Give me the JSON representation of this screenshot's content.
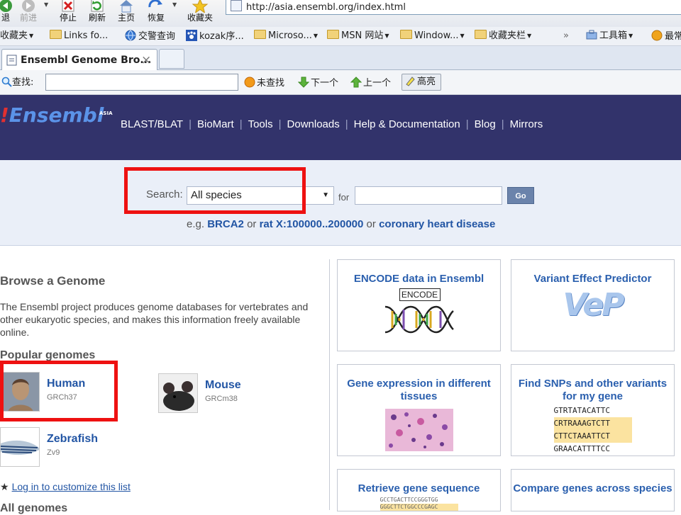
{
  "browser": {
    "nav_buttons": [
      {
        "label": "退",
        "icon": "back-icon"
      },
      {
        "label": "前进",
        "icon": "forward-icon"
      },
      {
        "label": "停止",
        "icon": "stop-icon"
      },
      {
        "label": "刷新",
        "icon": "refresh-icon"
      },
      {
        "label": "主页",
        "icon": "home-icon"
      },
      {
        "label": "恢复",
        "icon": "restore-icon"
      },
      {
        "label": "收藏夹",
        "icon": "favorites-star-icon"
      }
    ],
    "url": "http://asia.ensembl.org/index.html",
    "favorites": [
      {
        "label": "收藏夹",
        "icon": "favorites-icon"
      },
      {
        "label": "Links fo...",
        "icon": "folder-icon"
      },
      {
        "label": "交警查询",
        "icon": "globe-icon"
      },
      {
        "label": "kozak序...",
        "icon": "paw-icon"
      },
      {
        "label": "Microso...",
        "icon": "folder-icon"
      },
      {
        "label": "MSN 网站",
        "icon": "folder-icon"
      },
      {
        "label": "Window...",
        "icon": "folder-icon"
      },
      {
        "label": "收藏夹栏",
        "icon": "folder-icon"
      }
    ],
    "overflow": "»",
    "toolbox_label": "工具箱",
    "most_label": "最常",
    "tab_title": "Ensembl Genome Bro...",
    "tab_close": "×",
    "find": {
      "label": "查找:",
      "not_found": "未查找",
      "next": "下一个",
      "prev": "上一个",
      "highlight": "高亮"
    }
  },
  "site": {
    "logo_text": "Ensembl",
    "logo_sub": "ASIA",
    "nav": [
      "BLAST/BLAT",
      "BioMart",
      "Tools",
      "Downloads",
      "Help & Documentation",
      "Blog",
      "Mirrors"
    ],
    "search": {
      "label": "Search:",
      "species_value": "All species",
      "for_label": "for",
      "go_label": "Go",
      "example_prefix": "e.g.",
      "examples": [
        "BRCA2",
        "rat X:100000..200000",
        "coronary heart disease"
      ],
      "or": "or"
    },
    "browse": {
      "heading": "Browse a Genome",
      "intro": "The Ensembl project produces genome databases for vertebrates and other eukaryotic species, and makes this information freely available online.",
      "popular_heading": "Popular genomes",
      "genomes": [
        {
          "name": "Human",
          "assembly": "GRCh37"
        },
        {
          "name": "Mouse",
          "assembly": "GRCm38"
        },
        {
          "name": "Zebrafish",
          "assembly": "Zv9"
        }
      ],
      "login_link": "Log in to customize this list",
      "all_genomes": "All genomes"
    },
    "cards": [
      {
        "title": "ENCODE data in Ensembl",
        "image_text": "ENCODE"
      },
      {
        "title": "Variant Effect Predictor",
        "image_text": "VeP"
      },
      {
        "title": "Gene expression in different tissues"
      },
      {
        "title": "Find SNPs and other variants for my gene",
        "seq": [
          "GTRTATACATTC",
          "CRTRAAAGTCTT",
          "CTTCTAAATTCT",
          "GRAACATTTTCC"
        ]
      },
      {
        "title": "Retrieve gene sequence",
        "seq": [
          "GCCTGACTTCCGGGTGG",
          "GGGCTTCTGGCCCGAGC"
        ]
      },
      {
        "title": "Compare genes across species"
      }
    ]
  },
  "colors": {
    "header_bg": "#32336b",
    "link": "#2255a4",
    "annotation": "#ee1111"
  }
}
